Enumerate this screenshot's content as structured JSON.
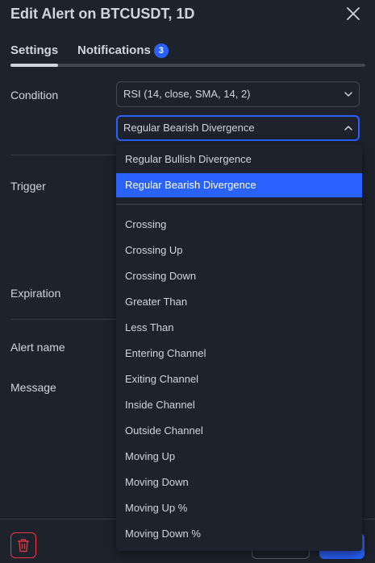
{
  "header": {
    "title": "Edit Alert on BTCUSDT, 1D"
  },
  "tabs": [
    {
      "label": "Settings",
      "active": true
    },
    {
      "label": "Notifications",
      "badge": "3"
    }
  ],
  "form": {
    "condition_label": "Condition",
    "condition_value": "RSI (14, close, SMA, 14, 2)",
    "condition_operator": "Regular Bearish Divergence",
    "trigger_label": "Trigger",
    "expiration_label": "Expiration",
    "alert_name_label": "Alert name",
    "message_label": "Message"
  },
  "dropdown": {
    "options": [
      "Regular Bullish Divergence",
      "Regular Bearish Divergence",
      "Crossing",
      "Crossing Up",
      "Crossing Down",
      "Greater Than",
      "Less Than",
      "Entering Channel",
      "Exiting Channel",
      "Inside Channel",
      "Outside Channel",
      "Moving Up",
      "Moving Down",
      "Moving Up %",
      "Moving Down %"
    ],
    "selected": "Regular Bearish Divergence"
  },
  "colors": {
    "background": "#1e222d",
    "accent": "#2962ff",
    "danger": "#f23645",
    "text": "#d1d4dc"
  }
}
